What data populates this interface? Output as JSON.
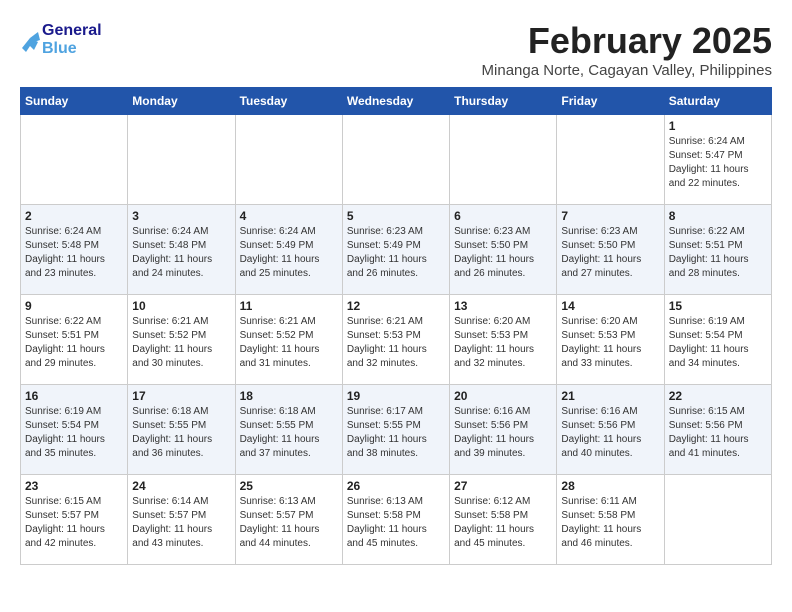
{
  "header": {
    "logo_line1": "General",
    "logo_line2": "Blue",
    "month": "February 2025",
    "location": "Minanga Norte, Cagayan Valley, Philippines"
  },
  "days_of_week": [
    "Sunday",
    "Monday",
    "Tuesday",
    "Wednesday",
    "Thursday",
    "Friday",
    "Saturday"
  ],
  "weeks": [
    [
      {
        "day": "",
        "content": ""
      },
      {
        "day": "",
        "content": ""
      },
      {
        "day": "",
        "content": ""
      },
      {
        "day": "",
        "content": ""
      },
      {
        "day": "",
        "content": ""
      },
      {
        "day": "",
        "content": ""
      },
      {
        "day": "1",
        "content": "Sunrise: 6:24 AM\nSunset: 5:47 PM\nDaylight: 11 hours\nand 22 minutes."
      }
    ],
    [
      {
        "day": "2",
        "content": "Sunrise: 6:24 AM\nSunset: 5:48 PM\nDaylight: 11 hours\nand 23 minutes."
      },
      {
        "day": "3",
        "content": "Sunrise: 6:24 AM\nSunset: 5:48 PM\nDaylight: 11 hours\nand 24 minutes."
      },
      {
        "day": "4",
        "content": "Sunrise: 6:24 AM\nSunset: 5:49 PM\nDaylight: 11 hours\nand 25 minutes."
      },
      {
        "day": "5",
        "content": "Sunrise: 6:23 AM\nSunset: 5:49 PM\nDaylight: 11 hours\nand 26 minutes."
      },
      {
        "day": "6",
        "content": "Sunrise: 6:23 AM\nSunset: 5:50 PM\nDaylight: 11 hours\nand 26 minutes."
      },
      {
        "day": "7",
        "content": "Sunrise: 6:23 AM\nSunset: 5:50 PM\nDaylight: 11 hours\nand 27 minutes."
      },
      {
        "day": "8",
        "content": "Sunrise: 6:22 AM\nSunset: 5:51 PM\nDaylight: 11 hours\nand 28 minutes."
      }
    ],
    [
      {
        "day": "9",
        "content": "Sunrise: 6:22 AM\nSunset: 5:51 PM\nDaylight: 11 hours\nand 29 minutes."
      },
      {
        "day": "10",
        "content": "Sunrise: 6:21 AM\nSunset: 5:52 PM\nDaylight: 11 hours\nand 30 minutes."
      },
      {
        "day": "11",
        "content": "Sunrise: 6:21 AM\nSunset: 5:52 PM\nDaylight: 11 hours\nand 31 minutes."
      },
      {
        "day": "12",
        "content": "Sunrise: 6:21 AM\nSunset: 5:53 PM\nDaylight: 11 hours\nand 32 minutes."
      },
      {
        "day": "13",
        "content": "Sunrise: 6:20 AM\nSunset: 5:53 PM\nDaylight: 11 hours\nand 32 minutes."
      },
      {
        "day": "14",
        "content": "Sunrise: 6:20 AM\nSunset: 5:53 PM\nDaylight: 11 hours\nand 33 minutes."
      },
      {
        "day": "15",
        "content": "Sunrise: 6:19 AM\nSunset: 5:54 PM\nDaylight: 11 hours\nand 34 minutes."
      }
    ],
    [
      {
        "day": "16",
        "content": "Sunrise: 6:19 AM\nSunset: 5:54 PM\nDaylight: 11 hours\nand 35 minutes."
      },
      {
        "day": "17",
        "content": "Sunrise: 6:18 AM\nSunset: 5:55 PM\nDaylight: 11 hours\nand 36 minutes."
      },
      {
        "day": "18",
        "content": "Sunrise: 6:18 AM\nSunset: 5:55 PM\nDaylight: 11 hours\nand 37 minutes."
      },
      {
        "day": "19",
        "content": "Sunrise: 6:17 AM\nSunset: 5:55 PM\nDaylight: 11 hours\nand 38 minutes."
      },
      {
        "day": "20",
        "content": "Sunrise: 6:16 AM\nSunset: 5:56 PM\nDaylight: 11 hours\nand 39 minutes."
      },
      {
        "day": "21",
        "content": "Sunrise: 6:16 AM\nSunset: 5:56 PM\nDaylight: 11 hours\nand 40 minutes."
      },
      {
        "day": "22",
        "content": "Sunrise: 6:15 AM\nSunset: 5:56 PM\nDaylight: 11 hours\nand 41 minutes."
      }
    ],
    [
      {
        "day": "23",
        "content": "Sunrise: 6:15 AM\nSunset: 5:57 PM\nDaylight: 11 hours\nand 42 minutes."
      },
      {
        "day": "24",
        "content": "Sunrise: 6:14 AM\nSunset: 5:57 PM\nDaylight: 11 hours\nand 43 minutes."
      },
      {
        "day": "25",
        "content": "Sunrise: 6:13 AM\nSunset: 5:57 PM\nDaylight: 11 hours\nand 44 minutes."
      },
      {
        "day": "26",
        "content": "Sunrise: 6:13 AM\nSunset: 5:58 PM\nDaylight: 11 hours\nand 45 minutes."
      },
      {
        "day": "27",
        "content": "Sunrise: 6:12 AM\nSunset: 5:58 PM\nDaylight: 11 hours\nand 45 minutes."
      },
      {
        "day": "28",
        "content": "Sunrise: 6:11 AM\nSunset: 5:58 PM\nDaylight: 11 hours\nand 46 minutes."
      },
      {
        "day": "",
        "content": ""
      }
    ]
  ]
}
